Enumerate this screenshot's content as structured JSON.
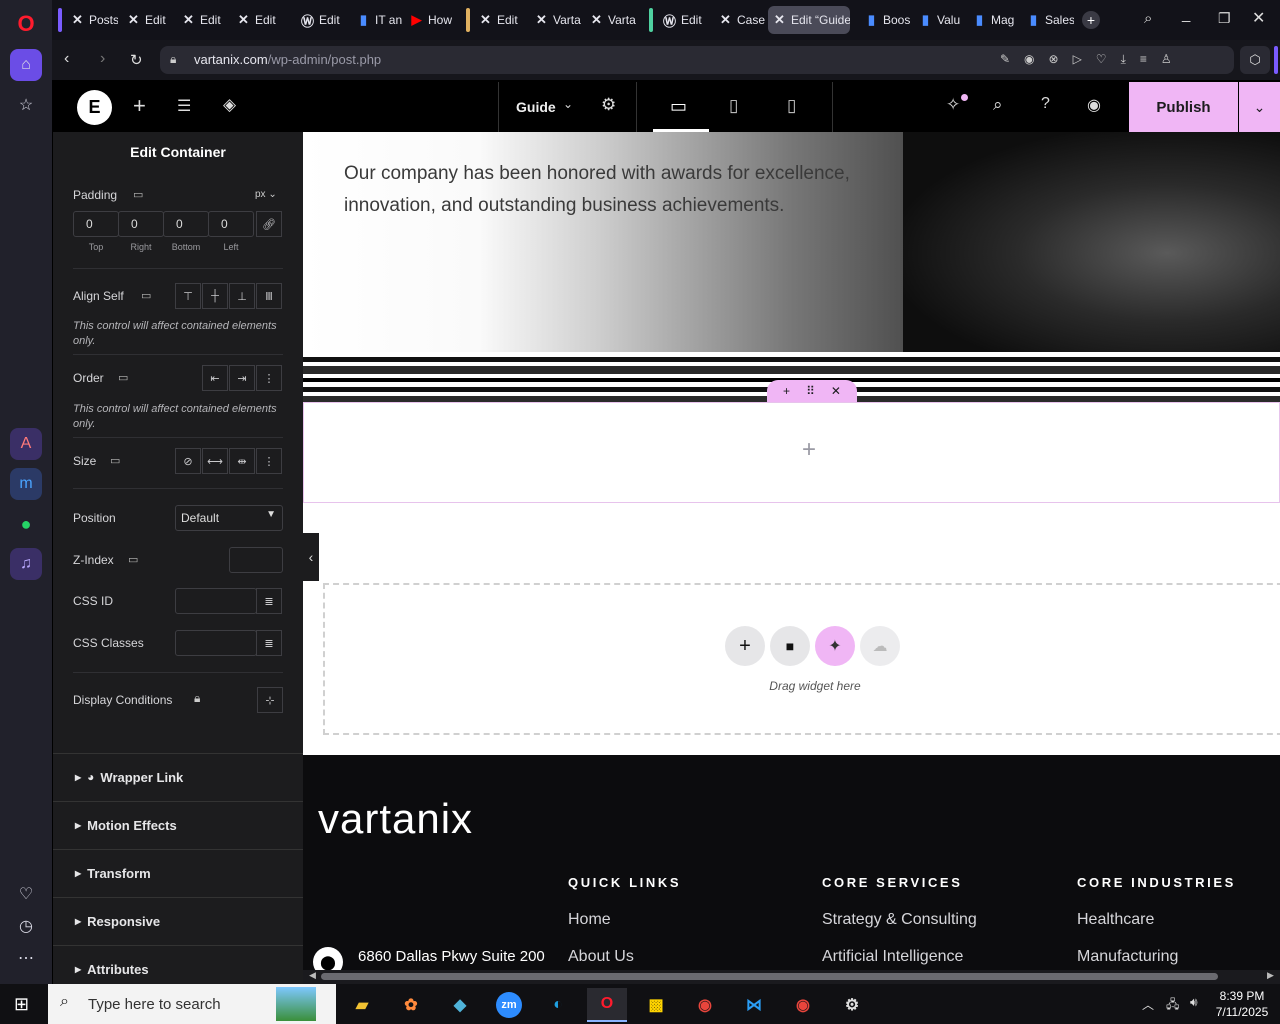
{
  "browser": {
    "tabs": [
      {
        "label": "Posts",
        "icon": "x-icon"
      },
      {
        "label": "Edit",
        "icon": "x-icon"
      },
      {
        "label": "Edit",
        "icon": "x-icon"
      },
      {
        "label": "Edit",
        "icon": "x-icon"
      },
      {
        "label": "Edit",
        "icon": "wordpress-icon"
      },
      {
        "label": "IT an",
        "icon": "doc-icon"
      },
      {
        "label": "How",
        "icon": "youtube-icon"
      },
      {
        "label": "Edit",
        "icon": "x-icon"
      },
      {
        "label": "Varta",
        "icon": "x-icon"
      },
      {
        "label": "Varta",
        "icon": "x-icon"
      },
      {
        "label": "Edit",
        "icon": "wordpress-icon"
      },
      {
        "label": "Case",
        "icon": "x-icon"
      },
      {
        "label": "Edit “Guide",
        "icon": "x-icon"
      },
      {
        "label": "Boos",
        "icon": "doc-icon"
      },
      {
        "label": "Valu",
        "icon": "doc-icon"
      },
      {
        "label": "Mag",
        "icon": "doc-icon"
      },
      {
        "label": "Sales",
        "icon": "doc-icon"
      }
    ],
    "url_domain": "vartanix.com",
    "url_path": "/wp-admin/post.php"
  },
  "editor": {
    "template_label": "Guide",
    "publish_label": "Publish",
    "panel_title": "Edit Container",
    "padding": {
      "label": "Padding",
      "unit": "px",
      "top": "0",
      "right": "0",
      "bottom": "0",
      "left": "0",
      "top_label": "Top",
      "right_label": "Right",
      "bottom_label": "Bottom",
      "left_label": "Left"
    },
    "align_self_label": "Align Self",
    "contained_note": "This control will affect contained elements only.",
    "order_label": "Order",
    "size_label": "Size",
    "position_label": "Position",
    "position_value": "Default",
    "zindex_label": "Z-Index",
    "cssid_label": "CSS ID",
    "cssclasses_label": "CSS Classes",
    "display_conditions_label": "Display Conditions",
    "sections": [
      "Wrapper Link",
      "Motion Effects",
      "Transform",
      "Responsive",
      "Attributes"
    ]
  },
  "canvas": {
    "hero_text": "Our company has been honored with awards for excellence, innovation, and outstanding business achievements.",
    "drag_widget_text": "Drag widget here",
    "footer": {
      "logo": "vartanix",
      "address": "6860 Dallas Pkwy Suite 200",
      "columns": [
        {
          "heading": "QUICK LINKS",
          "links": [
            "Home",
            "About Us"
          ]
        },
        {
          "heading": "CORE SERVICES",
          "links": [
            "Strategy & Consulting",
            "Artificial Intelligence"
          ]
        },
        {
          "heading": "CORE INDUSTRIES",
          "links": [
            "Healthcare",
            "Manufacturing"
          ]
        }
      ]
    }
  },
  "taskbar": {
    "search_placeholder": "Type here to search",
    "time": "8:39 PM",
    "date": "7/11/2025"
  },
  "colors": {
    "accent_pink": "#f0b6f5",
    "opera_red": "#ff1b2d",
    "panel_bg": "#1c1c1e"
  }
}
